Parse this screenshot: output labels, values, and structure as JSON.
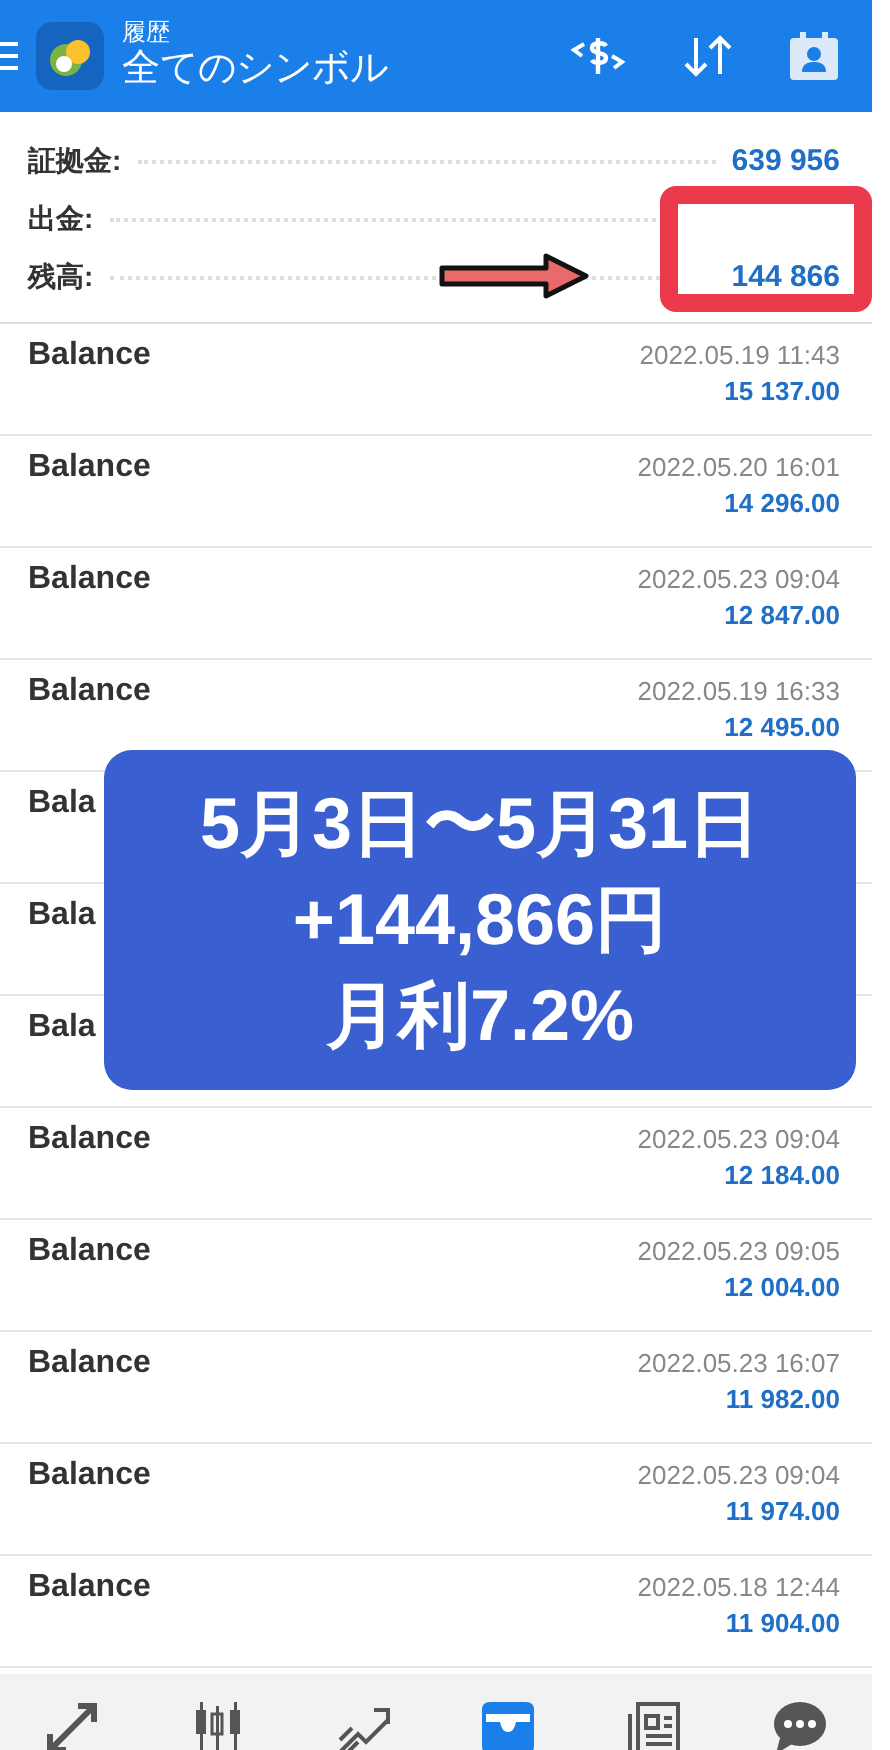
{
  "header": {
    "subtitle": "履歴",
    "title": "全てのシンボル"
  },
  "summary": [
    {
      "label": "証拠金:",
      "value": "639 956",
      "highlighted": false
    },
    {
      "label": "出金:",
      "highlighted": false
    },
    {
      "label": "残高:",
      "value": "144 866",
      "highlighted": true
    }
  ],
  "rows": [
    {
      "name": "Balance",
      "time": "2022.05.19 11:43",
      "amount": "15 137.00"
    },
    {
      "name": "Balance",
      "time": "2022.05.20 16:01",
      "amount": "14 296.00"
    },
    {
      "name": "Balance",
      "time": "2022.05.23 09:04",
      "amount": "12 847.00"
    },
    {
      "name": "Balance",
      "time": "2022.05.19 16:33",
      "amount": "12 495.00"
    },
    {
      "name": "Bala"
    },
    {
      "name": "Bala"
    },
    {
      "name": "Bala"
    },
    {
      "name": "Balance",
      "time": "2022.05.23 09:04",
      "amount": "12 184.00"
    },
    {
      "name": "Balance",
      "time": "2022.05.23 09:05",
      "amount": "12 004.00"
    },
    {
      "name": "Balance",
      "time": "2022.05.23 16:07",
      "amount": "11 982.00"
    },
    {
      "name": "Balance",
      "time": "2022.05.23 09:04",
      "amount": "11 974.00"
    },
    {
      "name": "Balance",
      "time": "2022.05.18 12:44",
      "amount": "11 904.00"
    }
  ],
  "overlay": {
    "lines": [
      "5月3日〜5月31日",
      "+144,866円",
      "月利7.2%"
    ]
  },
  "nav": [
    {
      "kind": "quotes",
      "selected": false
    },
    {
      "kind": "chart",
      "selected": false
    },
    {
      "kind": "trade",
      "selected": false
    },
    {
      "kind": "history",
      "selected": true
    },
    {
      "kind": "news",
      "selected": false
    },
    {
      "kind": "chat",
      "selected": false
    }
  ]
}
